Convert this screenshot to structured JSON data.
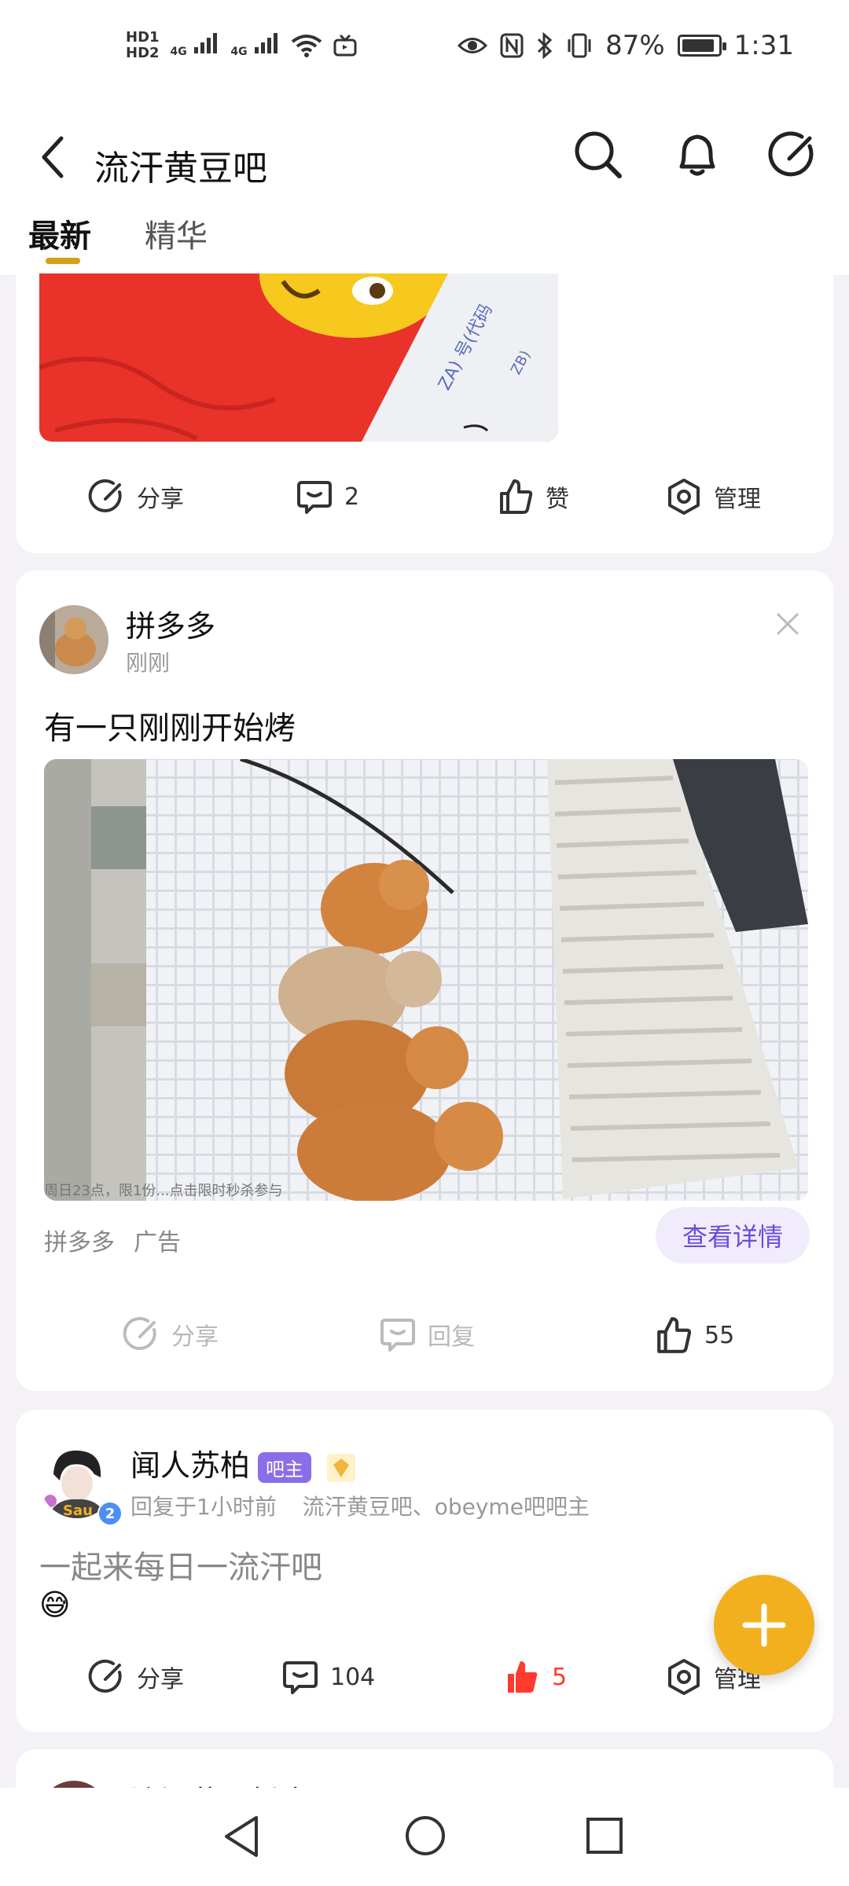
{
  "status_bar": {
    "hd1": "HD1",
    "hd2": "HD2",
    "net1": "4G",
    "net2": "4G",
    "battery_percent": "87%",
    "time": "1:31",
    "battery_level": 0.87
  },
  "header": {
    "title": "流汗黄豆吧",
    "tabs": [
      {
        "label": "最新",
        "active": true
      },
      {
        "label": "精华",
        "active": false
      }
    ]
  },
  "posts": [
    {
      "actions": {
        "share": "分享",
        "comment_count": "2",
        "like": "赞",
        "manage": "管理"
      },
      "image_text": [
        "ZA) 号(代码",
        "ZB)"
      ]
    },
    {
      "author": "拼多多",
      "time": "刚刚",
      "title": "有一只刚刚开始烤",
      "image_caption": "周日23点，限1份...点击限时秒杀参与",
      "ad_source": "拼多多",
      "ad_label": "广告",
      "detail_button": "查看详情",
      "actions": {
        "share": "分享",
        "reply": "回复",
        "likes": "55"
      }
    },
    {
      "author": "闻人苏柏",
      "role_badge": "吧主",
      "level": "2",
      "meta": "回复于1小时前",
      "roles_text": "流汗黄豆吧、obeyme吧吧主",
      "content": "一起来每日一流汗吧",
      "emoji": "😅",
      "actions": {
        "share": "分享",
        "comment_count": "104",
        "likes": "5",
        "manage": "管理"
      }
    },
    {
      "author_partial": "流汗黄豆析床"
    }
  ],
  "colors": {
    "accent_gold": "#d4a017",
    "fab": "#f2b01e",
    "purple": "#6b4dd8",
    "like_red": "#ff3b30"
  }
}
